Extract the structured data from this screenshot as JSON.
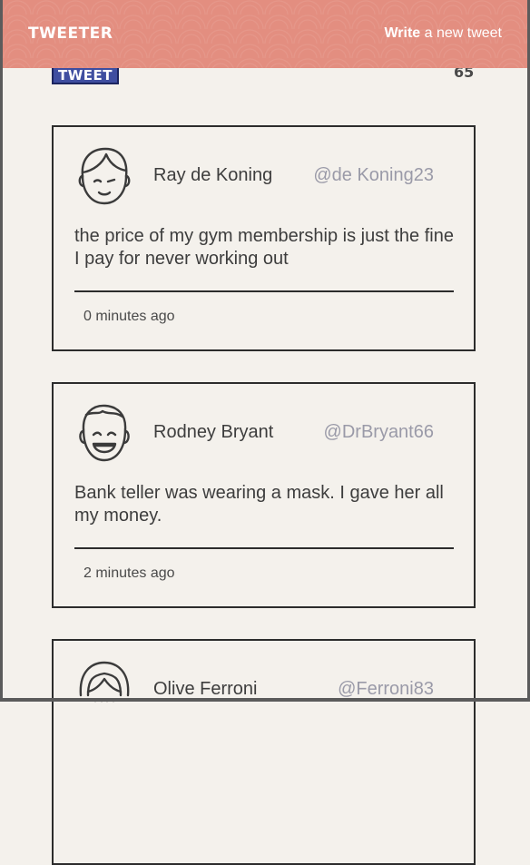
{
  "nav": {
    "brand": "TWEETER",
    "compose_bold": "Write",
    "compose_rest": " a new tweet"
  },
  "composer": {
    "tweet_button": "TWEET",
    "char_counter": "65"
  },
  "tweets": [
    {
      "name": "Ray de Koning",
      "handle": "@de Koning23",
      "text": "the price of my gym membership is just the fine I pay for never working out",
      "time": "0 minutes ago",
      "avatar_icon": "smiling-boy-avatar-icon"
    },
    {
      "name": "Rodney Bryant",
      "handle": "@DrBryant66",
      "text": "Bank teller was wearing a mask. I gave her all my money.",
      "time": "2 minutes ago",
      "avatar_icon": "laughing-man-avatar-icon"
    },
    {
      "name": "Olive Ferroni",
      "handle": "@Ferroni83",
      "text": "",
      "time": "",
      "avatar_icon": "woman-avatar-icon"
    }
  ],
  "colors": {
    "navbar": "#e38e80",
    "background": "#f4f1ec",
    "tweet_button": "#3f4ea0",
    "handle": "#9a9aa8"
  }
}
